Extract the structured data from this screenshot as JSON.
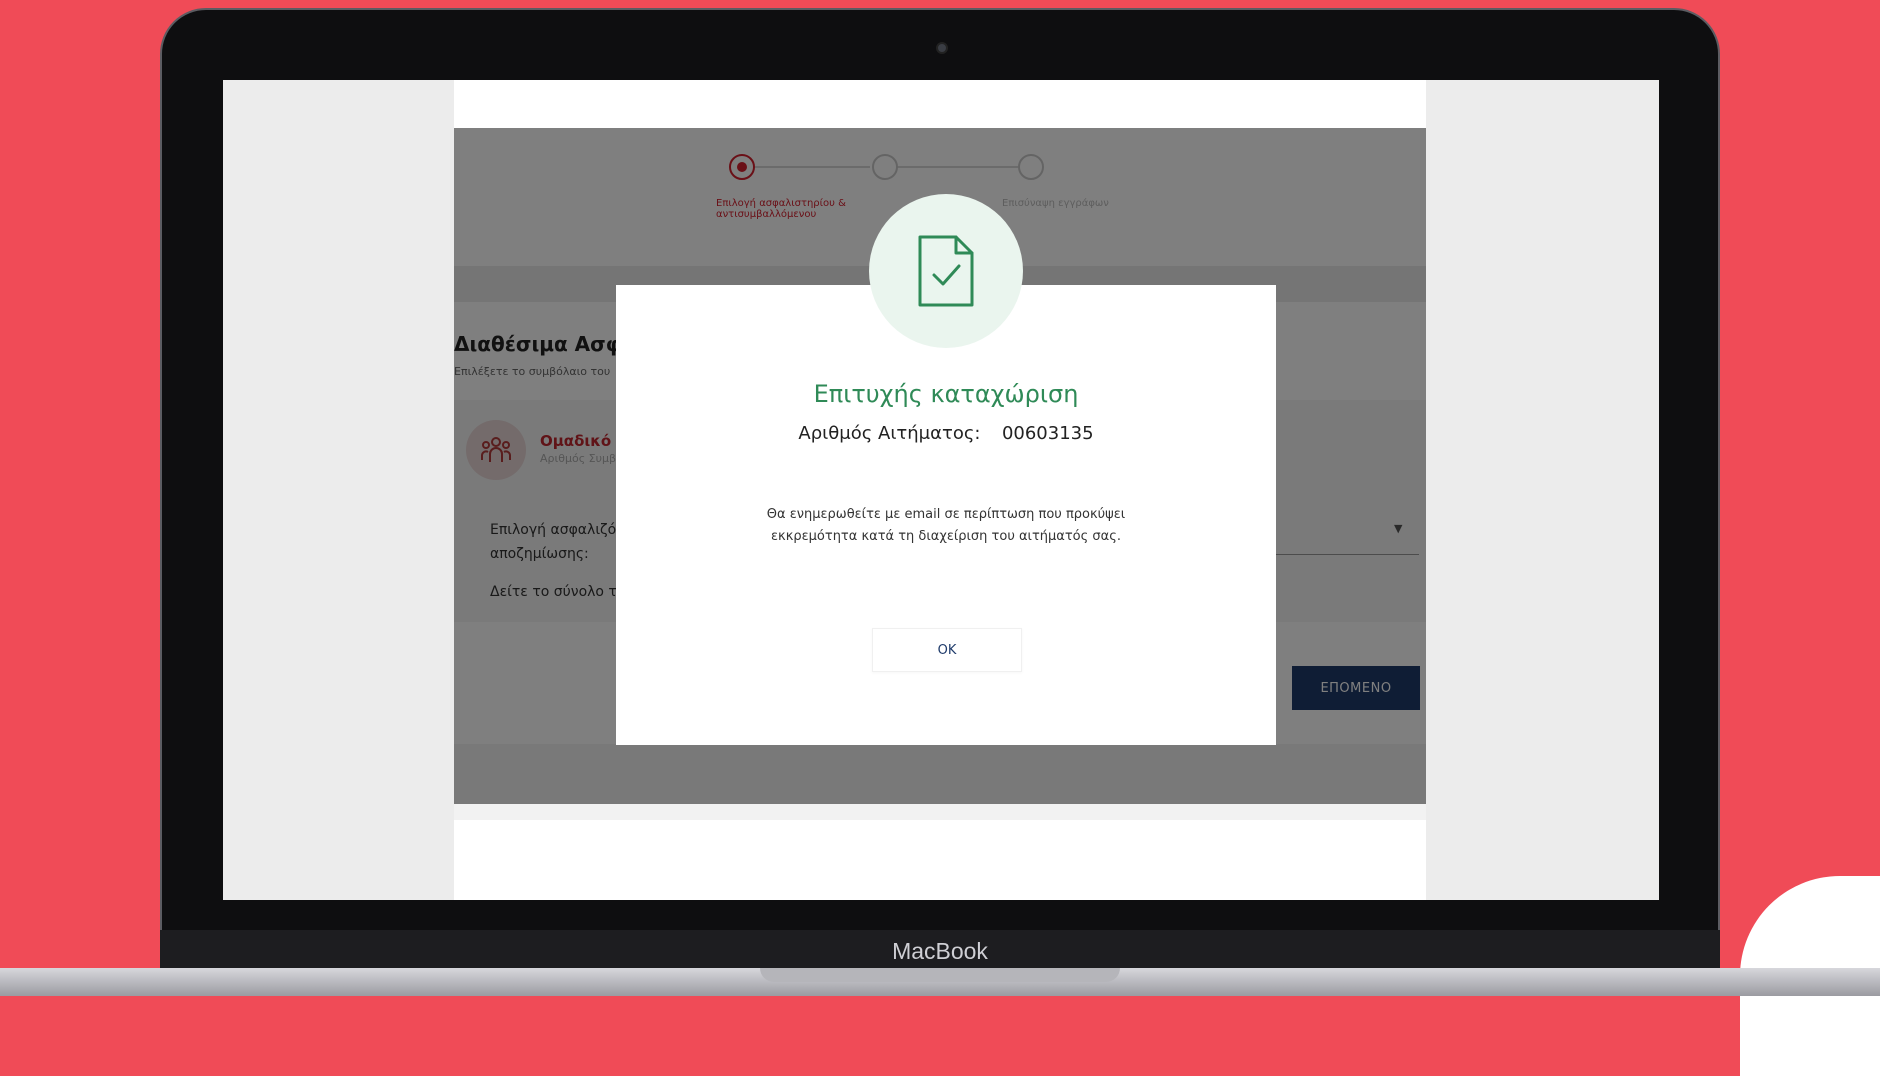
{
  "device": {
    "brand": "MacBook"
  },
  "stepper": {
    "steps": [
      {
        "label": "Επιλογή ασφαλιστηρίου & αντισυμβαλλόμενου",
        "active": true
      },
      {
        "label": "",
        "active": false
      },
      {
        "label": "Επισύναψη εγγράφων",
        "active": false
      }
    ]
  },
  "section": {
    "title": "Διαθέσιμα Ασφαλ",
    "subtitle": "Επιλέξετε το συμβόλαιο του"
  },
  "policy_card": {
    "title": "Ομαδικό Σ",
    "subtitle": "Αριθμός Συμβ",
    "field_label": "Επιλογή ασφαλιζό αποζημίωσης:",
    "link_text": "Δείτε το σύνολο τω"
  },
  "actions": {
    "next_label": "ΕΠΟΜΕΝΟ"
  },
  "modal": {
    "title": "Επιτυχής καταχώριση",
    "ref_label": "Αριθμός Αιτήματος:",
    "ref_value": "00603135",
    "message_line1": "Θα ενημερωθείτε με email σε περίπτωση που προκύψει",
    "message_line2": "εκκρεμότητα κατά τη διαχείριση του αιτήματός σας.",
    "ok_label": "OK"
  },
  "colors": {
    "background": "#f04b57",
    "success_green": "#2f8a57",
    "accent_red": "#d5212f",
    "primary_navy": "#1f3b6b"
  },
  "icons": {
    "success": "document-check-icon",
    "avatar": "group-users-icon",
    "caret": "caret-down-icon"
  }
}
